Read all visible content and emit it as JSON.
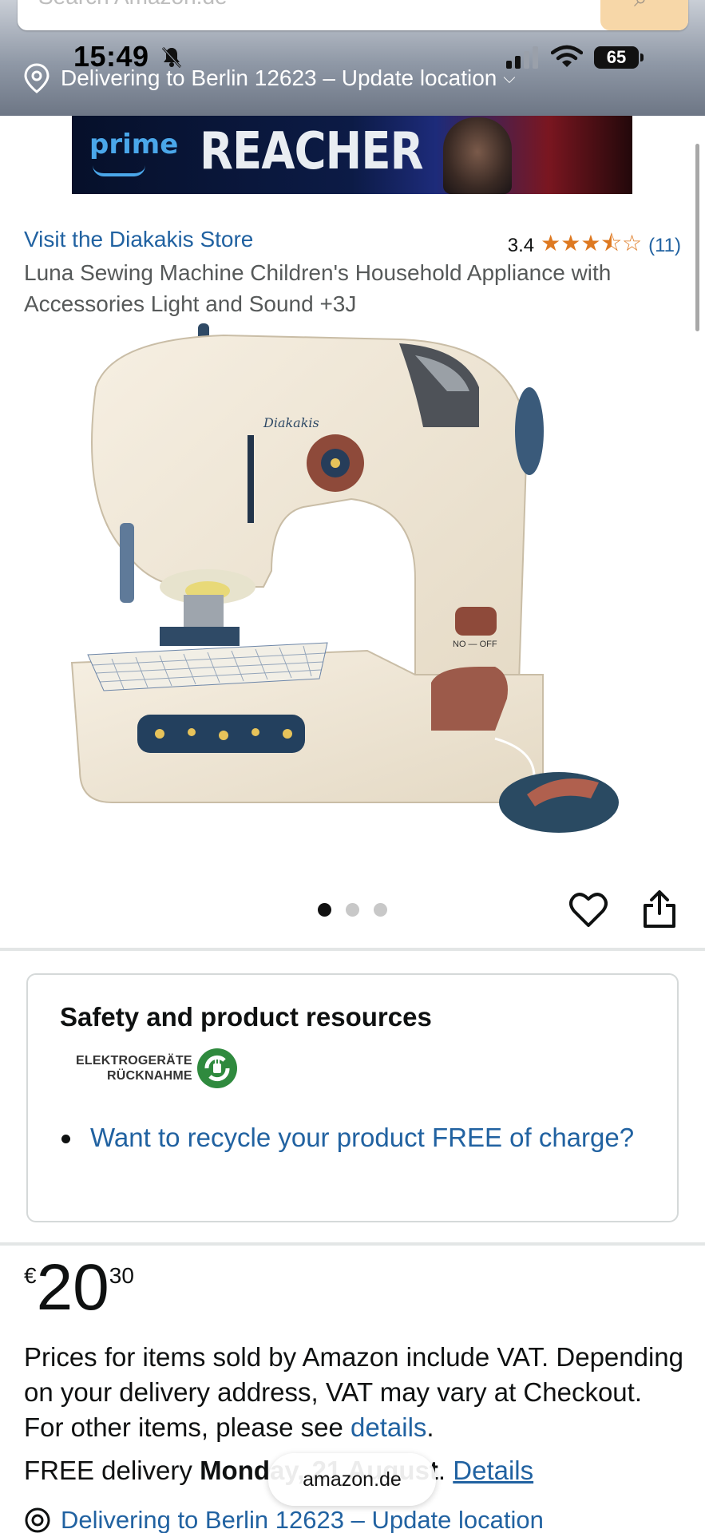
{
  "header": {
    "search_placeholder": "Search Amazon.de",
    "clock": "15:49",
    "battery": "65",
    "delivery_text": "Delivering to Berlin 12623 – Update location",
    "chevron": "⌵"
  },
  "banner": {
    "prime_label": "prime",
    "title": "REACHER"
  },
  "product": {
    "store_link": "Visit the Diakakis Store",
    "rating_value": "3.4",
    "stars": "★★★",
    "star_half": "⯪",
    "star_empty": "☆",
    "rating_count": "(11)",
    "title": "Luna Sewing Machine Children's Household Appliance with Accessories Light and Sound +3J",
    "image_text_brand": "Diakakis",
    "image_text_switch": "NO — OFF",
    "image_count": 3,
    "active_image": 1
  },
  "safety": {
    "heading": "Safety and product resources",
    "logo_line1": "ELEKTROGERÄTE",
    "logo_line2": "RÜCKNAHME",
    "link": "Want to recycle your product FREE of charge?"
  },
  "price": {
    "currency": "€",
    "whole": "20",
    "fraction": "30"
  },
  "vat": {
    "text": "Prices for items sold by Amazon include VAT. Depending on your delivery address, VAT may vary at Checkout. For other items, please see ",
    "link": "details",
    "end": "."
  },
  "delivery": {
    "prefix": "FREE delivery ",
    "date": "Monday, 21 August",
    "suffix": ". ",
    "details_link": "Details"
  },
  "browser": {
    "domain": "amazon.de"
  },
  "bottom_location": "Delivering to Berlin 12623 – Update location",
  "colors": {
    "link": "#2162a1",
    "star": "#de7921",
    "text": "#0f1111"
  }
}
